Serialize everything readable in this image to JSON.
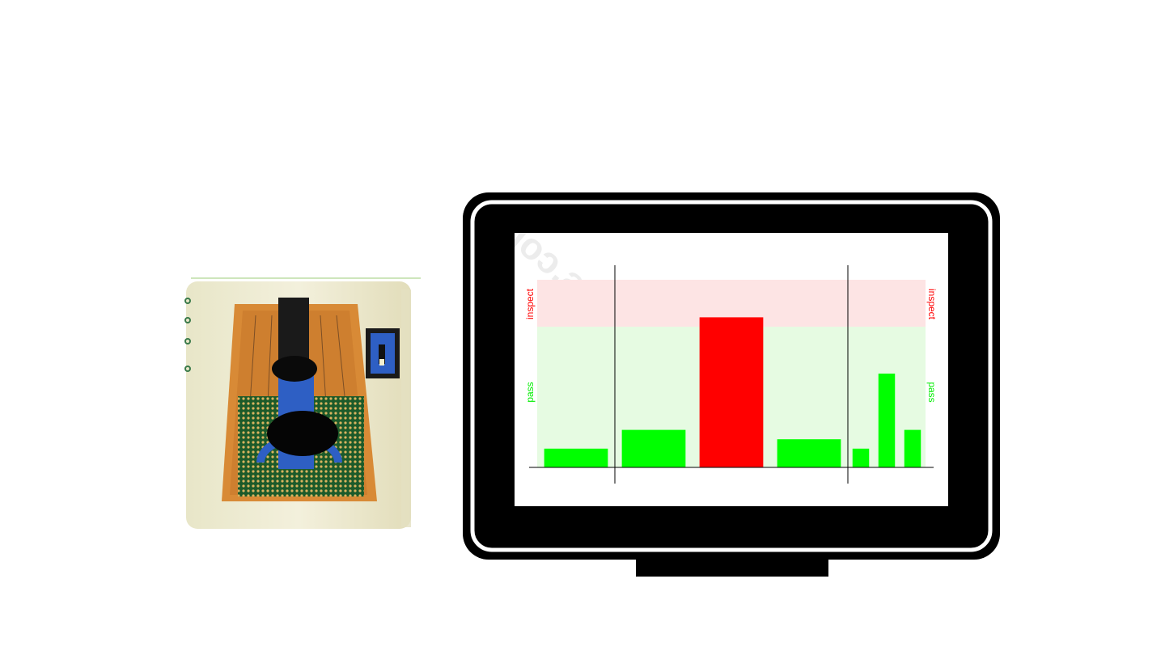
{
  "zones": {
    "inspect_label": "inspect",
    "pass_label": "pass",
    "inspect_color": "#ff0000",
    "pass_color": "#00ee00"
  },
  "watermark": "VectorToons.com",
  "chart_data": {
    "type": "bar",
    "title": "",
    "xlabel": "",
    "ylabel": "",
    "ylim": [
      0,
      10
    ],
    "bands": [
      {
        "label": "pass",
        "from": 0,
        "to": 7.5
      },
      {
        "label": "inspect",
        "from": 7.5,
        "to": 10
      }
    ],
    "groups": [
      {
        "values": [
          1
        ]
      },
      {
        "values": [
          2,
          8,
          1.5
        ]
      },
      {
        "values": [
          1,
          5,
          2
        ]
      }
    ],
    "bar_colors": [
      "#00ff00",
      "#00ff00",
      "#ff0000",
      "#00ff00",
      "#00ff00",
      "#00ff00",
      "#00ff00"
    ]
  }
}
